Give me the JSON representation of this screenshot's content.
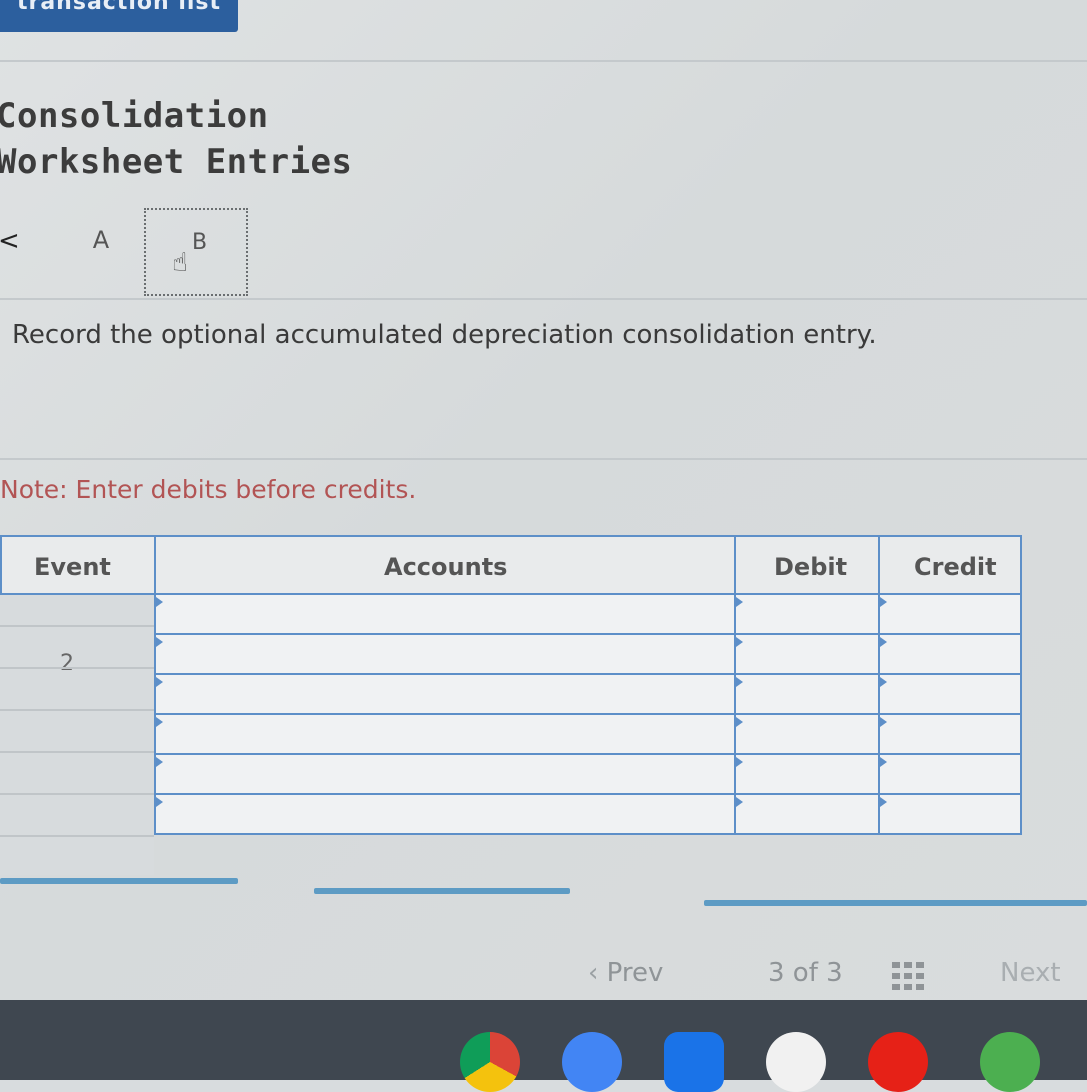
{
  "header": {
    "transaction_list_label": "transaction list"
  },
  "title": {
    "line1": "Consolidation",
    "line2": "Worksheet Entries"
  },
  "tabs": {
    "prev_glyph": "<",
    "tab_a": "A",
    "tab_b": "B"
  },
  "instruction": "Record the optional accumulated depreciation consolidation entry.",
  "note": "Note: Enter debits before credits.",
  "table": {
    "columns": {
      "event": "Event",
      "accounts": "Accounts",
      "debit": "Debit",
      "credit": "Credit"
    },
    "event_value": "2",
    "rows": [
      {
        "account": "",
        "debit": "",
        "credit": ""
      },
      {
        "account": "",
        "debit": "",
        "credit": ""
      },
      {
        "account": "",
        "debit": "",
        "credit": ""
      },
      {
        "account": "",
        "debit": "",
        "credit": ""
      },
      {
        "account": "",
        "debit": "",
        "credit": ""
      },
      {
        "account": "",
        "debit": "",
        "credit": ""
      }
    ]
  },
  "pagination": {
    "prev_label": "Prev",
    "page_info": "3 of 3",
    "next_label": "Next"
  },
  "colors": {
    "accent": "#2c5f9e",
    "table_border": "#5d8fc8",
    "note_text": "#b25454"
  },
  "taskbar_icons": [
    "chrome-icon",
    "docs-icon",
    "files-icon",
    "gmail-icon",
    "youtube-icon",
    "maps-icon"
  ]
}
